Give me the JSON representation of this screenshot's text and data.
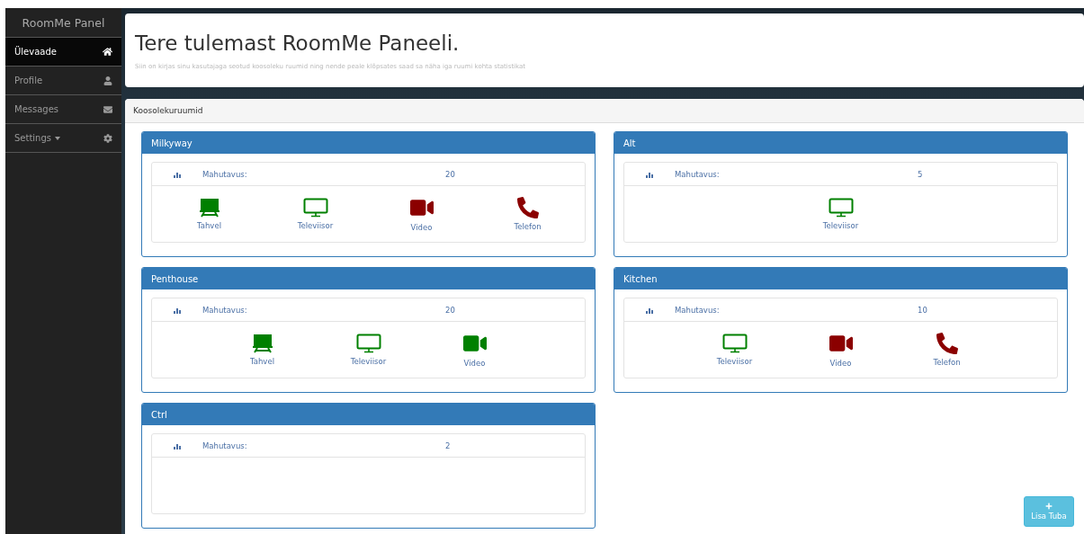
{
  "sidebar": {
    "brand": "RoomMe Panel",
    "items": [
      {
        "label": "Ülevaade",
        "kind": "home",
        "selected": true
      },
      {
        "label": "Profile",
        "kind": "user",
        "selected": false
      },
      {
        "label": "Messages",
        "kind": "mail",
        "selected": false
      },
      {
        "label": "Settings",
        "kind": "gear",
        "dropdown": true,
        "selected": false
      }
    ]
  },
  "header": {
    "title": "Tere tulemast RoomMe Paneeli.",
    "subtitle": "Siin on kirjas sinu kasutajaga seotud koosoleku ruumid ning nende peale klõpsates saad sa näha iga ruumi kohta statistikat"
  },
  "panel": {
    "title": "Koosolekuruumid",
    "rooms": [
      {
        "name": "Milkyway",
        "capacity_label": "Mahutavus:",
        "capacity": "20",
        "equipment": [
          {
            "kind": "board",
            "label": "Tahvel",
            "available": true
          },
          {
            "kind": "tv",
            "label": "Televiisor",
            "available": true
          },
          {
            "kind": "video",
            "label": "Video",
            "available": false
          },
          {
            "kind": "phone",
            "label": "Telefon",
            "available": false
          }
        ]
      },
      {
        "name": "Alt",
        "capacity_label": "Mahutavus:",
        "capacity": "5",
        "equipment": [
          {
            "kind": "tv",
            "label": "Televiisor",
            "available": true
          }
        ]
      },
      {
        "name": "Penthouse",
        "capacity_label": "Mahutavus:",
        "capacity": "20",
        "equipment": [
          {
            "kind": "board",
            "label": "Tahvel",
            "available": true
          },
          {
            "kind": "tv",
            "label": "Televiisor",
            "available": true
          },
          {
            "kind": "video",
            "label": "Video",
            "available": true
          }
        ]
      },
      {
        "name": "Kitchen",
        "capacity_label": "Mahutavus:",
        "capacity": "10",
        "equipment": [
          {
            "kind": "tv",
            "label": "Televiisor",
            "available": true
          },
          {
            "kind": "video",
            "label": "Video",
            "available": false
          },
          {
            "kind": "phone",
            "label": "Telefon",
            "available": false
          }
        ]
      },
      {
        "name": "Ctrl",
        "capacity_label": "Mahutavus:",
        "capacity": "2"
      }
    ]
  },
  "add_button": {
    "label": "Lisa Tuba"
  }
}
